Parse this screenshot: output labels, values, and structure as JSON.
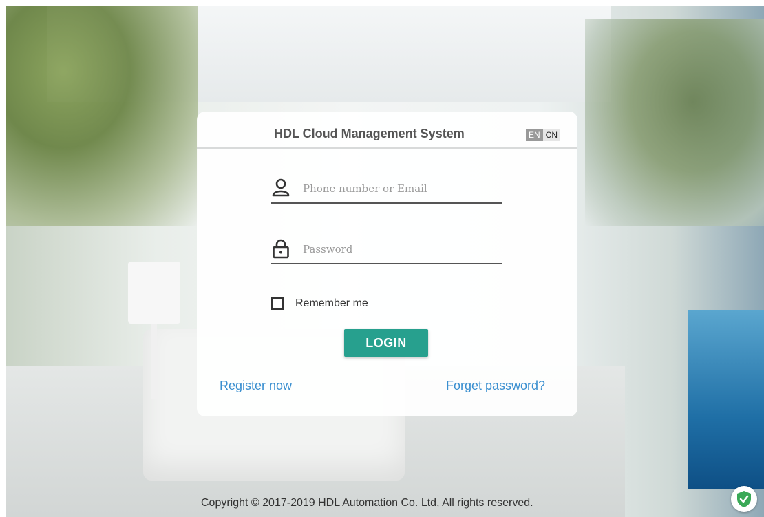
{
  "login_card": {
    "title": "HDL Cloud Management System",
    "languages": {
      "en": "EN",
      "cn": "CN",
      "active": "EN"
    },
    "username": {
      "placeholder": "Phone number or Email",
      "value": ""
    },
    "password": {
      "placeholder": "Password",
      "value": ""
    },
    "remember_me": {
      "label": "Remember me",
      "checked": false
    },
    "login_label": "LOGIN",
    "register_label": "Register now",
    "forgot_label": "Forget password?"
  },
  "footer": {
    "copyright": "Copyright © 2017-2019 HDL Automation Co. Ltd, All rights reserved."
  },
  "colors": {
    "accent": "#27a08e",
    "link": "#3a8fd0"
  },
  "icons": {
    "username": "user-icon",
    "password": "lock-icon",
    "security_badge": "shield-check-icon"
  }
}
